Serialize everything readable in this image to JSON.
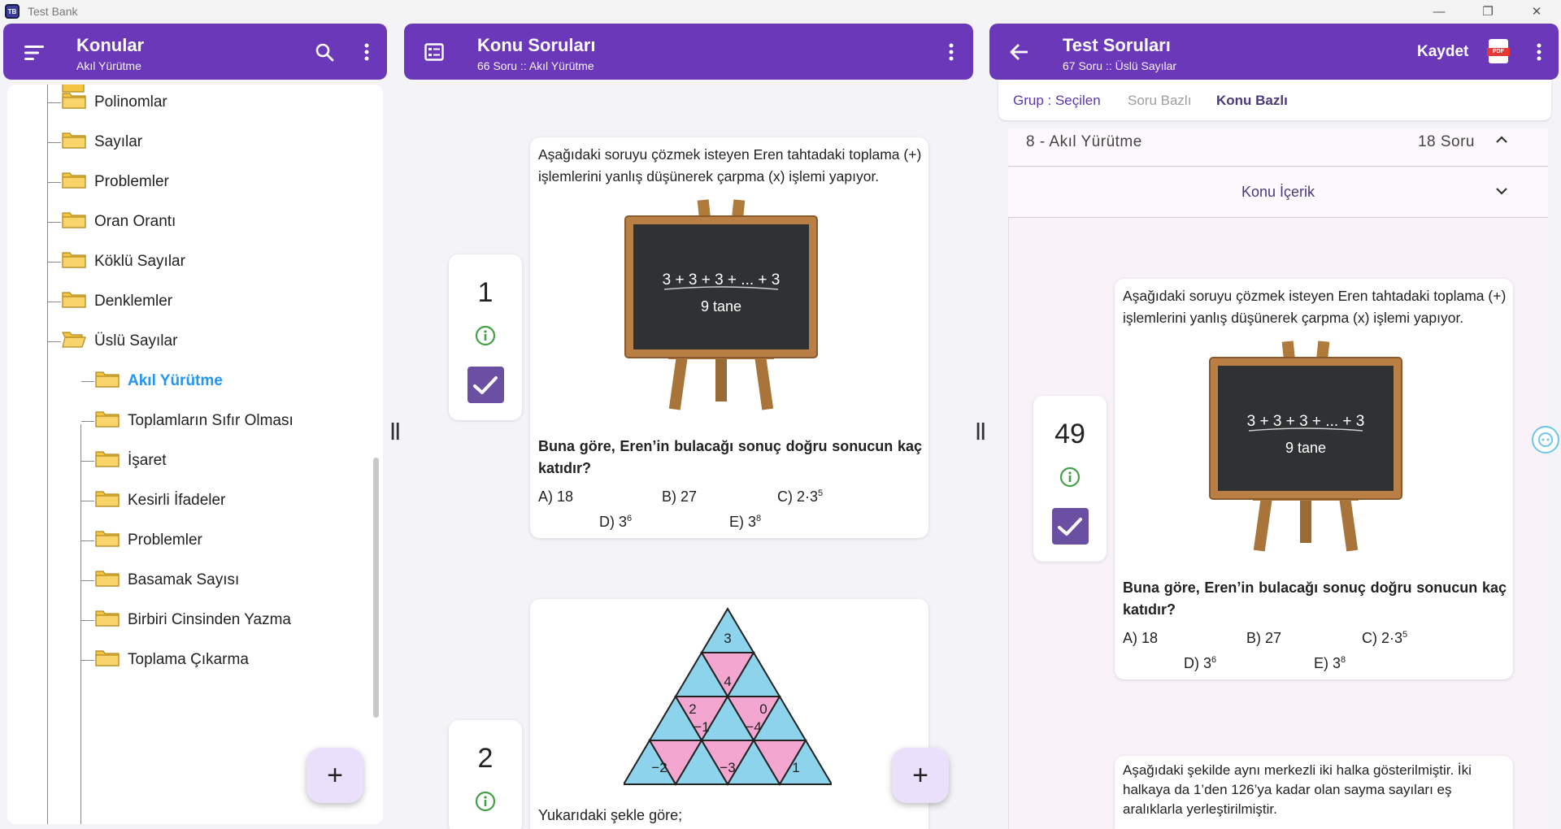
{
  "window": {
    "title": "Test Bank",
    "icon_text": "TB",
    "controls": [
      "—",
      "❐",
      "✕"
    ]
  },
  "left_header": {
    "title": "Konular",
    "subtitle": "Akıl Yürütme"
  },
  "tree": {
    "items": [
      {
        "label": "Polinomlar"
      },
      {
        "label": "Sayılar"
      },
      {
        "label": "Problemler"
      },
      {
        "label": "Oran Orantı"
      },
      {
        "label": "Köklü Sayılar"
      },
      {
        "label": "Denklemler"
      },
      {
        "label": "Üslü Sayılar",
        "open": true
      },
      {
        "label": "Akıl Yürütme",
        "selected": true
      },
      {
        "label": "Toplamların Sıfır Olması"
      },
      {
        "label": "İşaret"
      },
      {
        "label": "Kesirli İfadeler"
      },
      {
        "label": "Problemler"
      },
      {
        "label": "Basamak Sayısı"
      },
      {
        "label": "Birbiri Cinsinden Yazma"
      },
      {
        "label": "Toplama Çıkarma"
      }
    ]
  },
  "fab_label": "+",
  "splitter_glyph": "||",
  "middle_header": {
    "title": "Konu Soruları",
    "subtitle": "66 Soru :: Akıl Yürütme"
  },
  "right_header": {
    "title": "Test Soruları",
    "subtitle": "67 Soru :: Üslü Sayılar",
    "save_label": "Kaydet",
    "pdf_label": "PDF"
  },
  "right_tabs": [
    {
      "label": "Grup : Seçilen",
      "state": "active"
    },
    {
      "label": "Soru Bazlı",
      "state": "muted"
    },
    {
      "label": "Konu Bazlı",
      "state": "bold"
    }
  ],
  "accordion": {
    "title": "8 - Akıl Yürütme",
    "count": "18 Soru",
    "sub_title": "Konu İçerik"
  },
  "question1": {
    "number": "1",
    "intro": "Aşağıdaki soruyu çözmek isteyen Eren tahtadaki toplama (+) işlemlerini yanlış düşünerek çarpma (x) işlemi yapıyor.",
    "board_line1": "3 + 3 + 3 + ... + 3",
    "board_line2": "9 tane",
    "question": "Buna göre, Eren’in bulacağı sonuç doğru sonucun kaç katıdır?",
    "opt_a": "A) 18",
    "opt_b": "B) 27",
    "opt_c": "C) 2·3",
    "opt_c_exp": "5",
    "opt_d": "D) 3",
    "opt_d_exp": "6",
    "opt_e": "E) 3",
    "opt_e_exp": "8"
  },
  "question2": {
    "number": "2",
    "triangle_numbers": [
      "3",
      "4",
      "2",
      "0",
      "−1",
      "−4",
      "−2",
      "−3",
      "1"
    ],
    "question": "Yukarıdaki şekle göre;"
  },
  "right_question": {
    "number": "49",
    "next_intro": "Aşağıdaki şekilde aynı merkezli iki halka gösterilmiştir. İki halkaya da 1’den 126’ya kadar olan sayma sayıları eş aralıklarla yerleştirilmiştir."
  },
  "colors": {
    "brand_purple": "#6a38b8",
    "check_purple": "#6a4fa2",
    "selected_blue": "#2196f3",
    "info_green": "#43a047",
    "tri_blue": "#8dd3ec",
    "tri_pink": "#f3a6cf"
  }
}
